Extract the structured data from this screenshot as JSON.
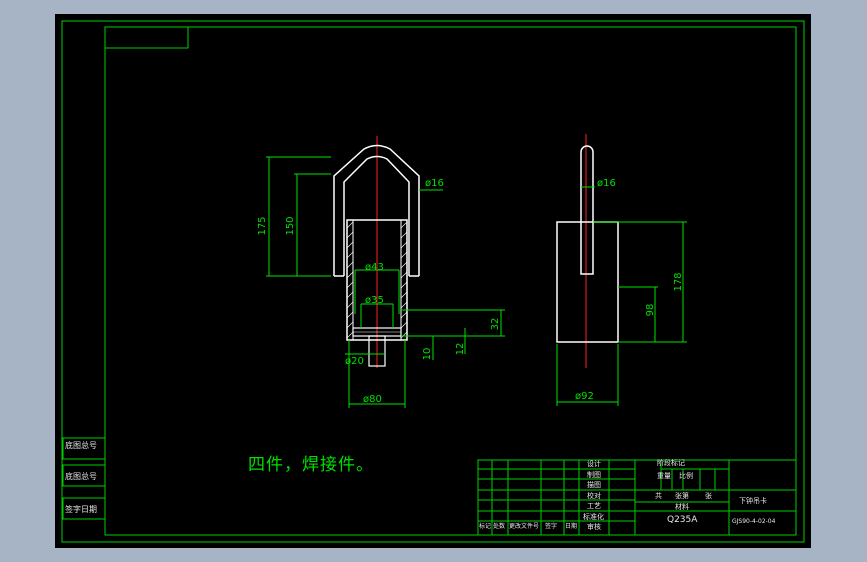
{
  "drawing": {
    "note": "四件，焊接件。",
    "colors": {
      "background": "#000000",
      "frame": "#00d000",
      "part_outline": "#ffffff",
      "centerline": "#ff2020",
      "dimension": "#00e000"
    },
    "front_view": {
      "dims": {
        "d175": "175",
        "d150": "150",
        "d16": "ø16",
        "d43": "ø43",
        "d35": "ø35",
        "d32": "32",
        "d12": "12",
        "d10": "10",
        "d20": "ø20",
        "d80": "ø80"
      }
    },
    "side_view": {
      "dims": {
        "d16": "ø16",
        "d178": "178",
        "d98": "98",
        "d92": "ø92"
      }
    },
    "side_labels": [
      "底图总号",
      "底图总号",
      "签字日期"
    ],
    "title_block": {
      "roles": [
        "设计",
        "制图",
        "描图",
        "校对",
        "工艺",
        "标准化",
        "审核"
      ],
      "bottom_row": [
        "标记",
        "处数",
        "更改文件号",
        "签字",
        "日期"
      ],
      "stage_label": "阶段标记",
      "weight_label": "重量",
      "scale_label": "比例",
      "sheet_info": [
        "共",
        "张第",
        "张"
      ],
      "material_label": "材料",
      "material": "Q235A",
      "part_name": "下钟吊卡",
      "drawing_number": "GJS90-4-02-04"
    }
  }
}
